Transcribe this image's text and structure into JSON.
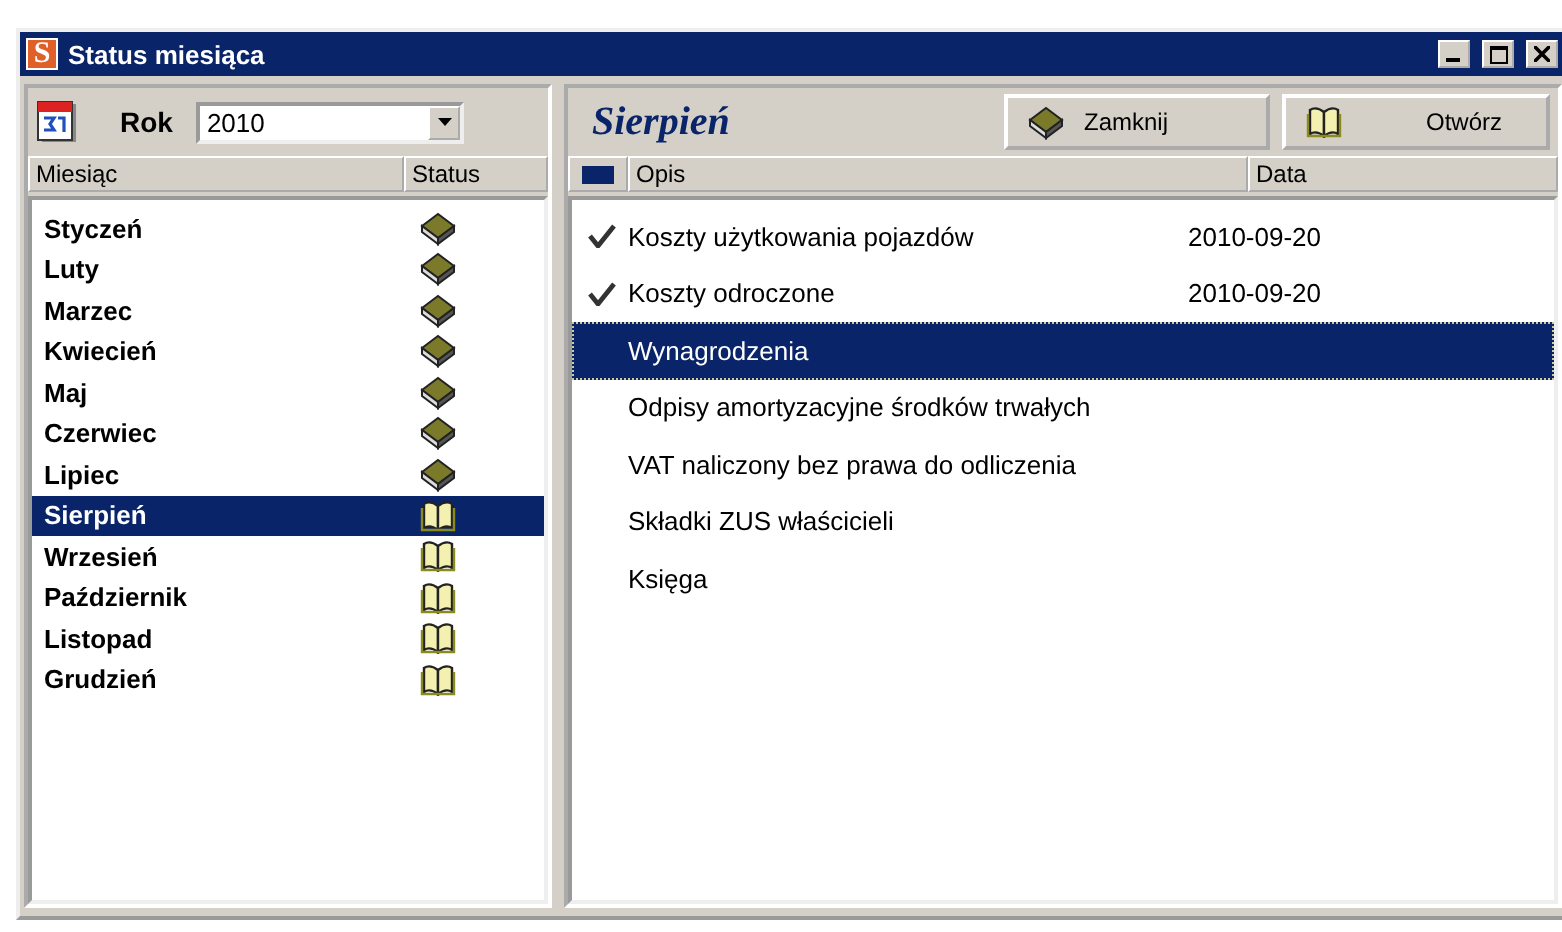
{
  "window": {
    "title": "Status miesiąca",
    "app_letter": "S"
  },
  "year": {
    "label": "Rok",
    "value": "2010"
  },
  "months": {
    "columns": [
      "Miesiąc",
      "Status"
    ],
    "rows": [
      {
        "name": "Styczeń",
        "closed": true,
        "selected": false
      },
      {
        "name": "Luty",
        "closed": true,
        "selected": false
      },
      {
        "name": "Marzec",
        "closed": true,
        "selected": false
      },
      {
        "name": "Kwiecień",
        "closed": true,
        "selected": false
      },
      {
        "name": "Maj",
        "closed": true,
        "selected": false
      },
      {
        "name": "Czerwiec",
        "closed": true,
        "selected": false
      },
      {
        "name": "Lipiec",
        "closed": true,
        "selected": false
      },
      {
        "name": "Sierpień",
        "closed": false,
        "selected": true
      },
      {
        "name": "Wrzesień",
        "closed": false,
        "selected": false
      },
      {
        "name": "Październik",
        "closed": false,
        "selected": false
      },
      {
        "name": "Listopad",
        "closed": false,
        "selected": false
      },
      {
        "name": "Grudzień",
        "closed": false,
        "selected": false
      }
    ]
  },
  "detail": {
    "heading": "Sierpień",
    "buttons": [
      {
        "kind": "close",
        "label": "Zamknij"
      },
      {
        "kind": "open",
        "label": "Otwórz"
      }
    ],
    "columns": [
      "Opis",
      "Data"
    ],
    "rows": [
      {
        "text": "Koszty użytkowania pojazdów",
        "date": "2010-09-20",
        "checked": true,
        "selected": false
      },
      {
        "text": "Koszty odroczone",
        "date": "2010-09-20",
        "checked": true,
        "selected": false
      },
      {
        "text": "Wynagrodzenia",
        "checked": false,
        "selected": true
      },
      {
        "text": "Odpisy amortyzacyjne środków trwałych",
        "checked": false,
        "selected": false
      },
      {
        "text": "VAT naliczony bez prawa do odliczenia",
        "checked": false,
        "selected": false
      },
      {
        "text": "Składki ZUS właścicieli",
        "checked": false,
        "selected": false
      },
      {
        "text": "Księga",
        "checked": false,
        "selected": false
      }
    ]
  }
}
